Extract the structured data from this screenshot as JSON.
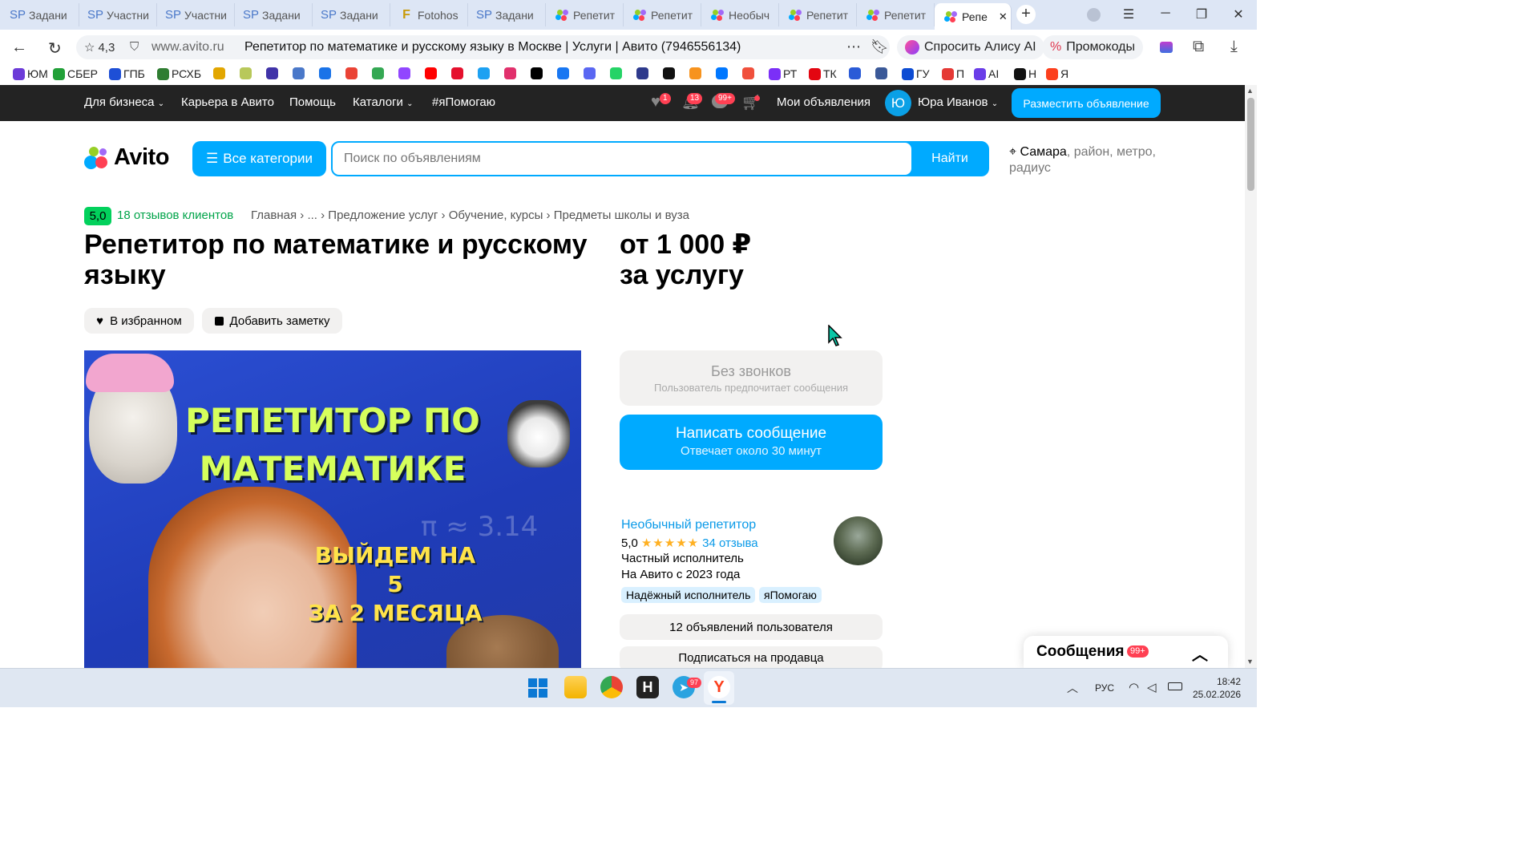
{
  "browser": {
    "tabs": [
      {
        "label": "Задани",
        "icon": "sp"
      },
      {
        "label": "Участни",
        "icon": "sp"
      },
      {
        "label": "Участни",
        "icon": "sp"
      },
      {
        "label": "Задани",
        "icon": "sp"
      },
      {
        "label": "Задани",
        "icon": "sp"
      },
      {
        "label": "Fotohos",
        "icon": "fotohosting"
      },
      {
        "label": "Задани",
        "icon": "sp"
      },
      {
        "label": "Репетит",
        "icon": "avito"
      },
      {
        "label": "Репетит",
        "icon": "avito"
      },
      {
        "label": "Необыч",
        "icon": "avito"
      },
      {
        "label": "Репетит",
        "icon": "avito"
      },
      {
        "label": "Репетит",
        "icon": "avito"
      },
      {
        "label": "Репе",
        "icon": "avito",
        "active": true
      }
    ],
    "site_rating": "4,3",
    "domain": "www.avito.ru",
    "page_title": "Репетитор по математике и русскому языку в Москве | Услуги | Авито (7946556134)",
    "alice_label": "Спросить Алису AI",
    "promo_label": "Промокоды",
    "bookmarks": [
      {
        "label": "ЮМ",
        "color": "#6c3bd8"
      },
      {
        "label": "СБЕР",
        "color": "#21a038"
      },
      {
        "label": "ГПБ",
        "color": "#1e4fd6"
      },
      {
        "label": "РСХБ",
        "color": "#2f7d32"
      },
      {
        "label": "",
        "color": "#e2a600"
      },
      {
        "label": "",
        "color": "#b8c85a"
      },
      {
        "label": "",
        "color": "#4033a8"
      },
      {
        "label": "",
        "color": "#4a78c9"
      },
      {
        "label": "",
        "color": "#1a73e8"
      },
      {
        "label": "",
        "color": "#ea4335"
      },
      {
        "label": "",
        "color": "#34a853"
      },
      {
        "label": "",
        "color": "#9146ff"
      },
      {
        "label": "",
        "color": "#ff0000"
      },
      {
        "label": "",
        "color": "#e5102d"
      },
      {
        "label": "",
        "color": "#1da1f2"
      },
      {
        "label": "",
        "color": "#e1306c"
      },
      {
        "label": "",
        "color": "#000000"
      },
      {
        "label": "",
        "color": "#1877f2"
      },
      {
        "label": "",
        "color": "#5a67f2"
      },
      {
        "label": "",
        "color": "#25d366"
      },
      {
        "label": "",
        "color": "#2e3a8c"
      },
      {
        "label": "",
        "color": "#111111"
      },
      {
        "label": "",
        "color": "#f7931e"
      },
      {
        "label": "",
        "color": "#0077ff"
      },
      {
        "label": "",
        "color": "#f0503c"
      },
      {
        "label": "РТ",
        "color": "#7b2ff7"
      },
      {
        "label": "ТК",
        "color": "#e30611"
      },
      {
        "label": "",
        "color": "#2a5bd7"
      },
      {
        "label": "",
        "color": "#3b5998"
      },
      {
        "label": "ГУ",
        "color": "#0d4cd3"
      },
      {
        "label": "П",
        "color": "#e53935"
      },
      {
        "label": "AI",
        "color": "#6a3de8"
      },
      {
        "label": "Н",
        "color": "#111111"
      },
      {
        "label": "Я",
        "color": "#fc3f1d"
      }
    ]
  },
  "topnav": {
    "business": "Для бизнеса",
    "career": "Карьера в Авито",
    "help": "Помощь",
    "catalogs": "Каталоги",
    "ihelp": "#яПомогаю",
    "fav_badge": "1",
    "notif_badge": "13",
    "msg_badge": "99+",
    "my_ads": "Мои объявления",
    "avatar_letter": "Ю",
    "user_name": "Юра Иванов",
    "post_ad": "Разместить объявление"
  },
  "search": {
    "logo": "Avito",
    "all_categories": "Все категории",
    "placeholder": "Поиск по объявлениям",
    "find": "Найти",
    "city": "Самара",
    "location_hint": ", район, метро, радиус"
  },
  "listing": {
    "rating": "5,0",
    "reviews": "18 отзывов клиентов",
    "breadcrumbs": [
      "Главная",
      "...",
      "Предложение услуг",
      "Обучение, курсы",
      "Предметы школы и вуза"
    ],
    "title": "Репетитор по математике и русскому языку",
    "price_line1": "от 1 000 ₽",
    "price_line2": "за услугу",
    "favorite": "В избранном",
    "add_note": "Добавить заметку",
    "image_text1": "РЕПЕТИТОР ПО",
    "image_text2": "МАТЕМАТИКЕ",
    "image_text3": "ВЫЙДЕМ НА 5",
    "image_text4": "ЗА 2 МЕСЯЦА"
  },
  "contact": {
    "no_calls": "Без звонков",
    "no_calls_sub": "Пользователь предпочитает сообщения",
    "write": "Написать сообщение",
    "write_sub": "Отвечает около 30 минут"
  },
  "seller": {
    "name": "Необычный репетитор",
    "rating": "5,0",
    "stars": 5,
    "reviews": "34 отзыва",
    "type": "Частный исполнитель",
    "since": "На Авито с 2023 года",
    "tags": [
      "Надёжный исполнитель",
      "яПомогаю"
    ],
    "ads_button": "12 объявлений пользователя",
    "subscribe": "Подписаться на продавца"
  },
  "messenger": {
    "title": "Сообщения",
    "badge": "99+"
  },
  "taskbar": {
    "lang": "РУС",
    "time": "18:42",
    "date": "25.02.2026",
    "telegram_badge": "97"
  }
}
